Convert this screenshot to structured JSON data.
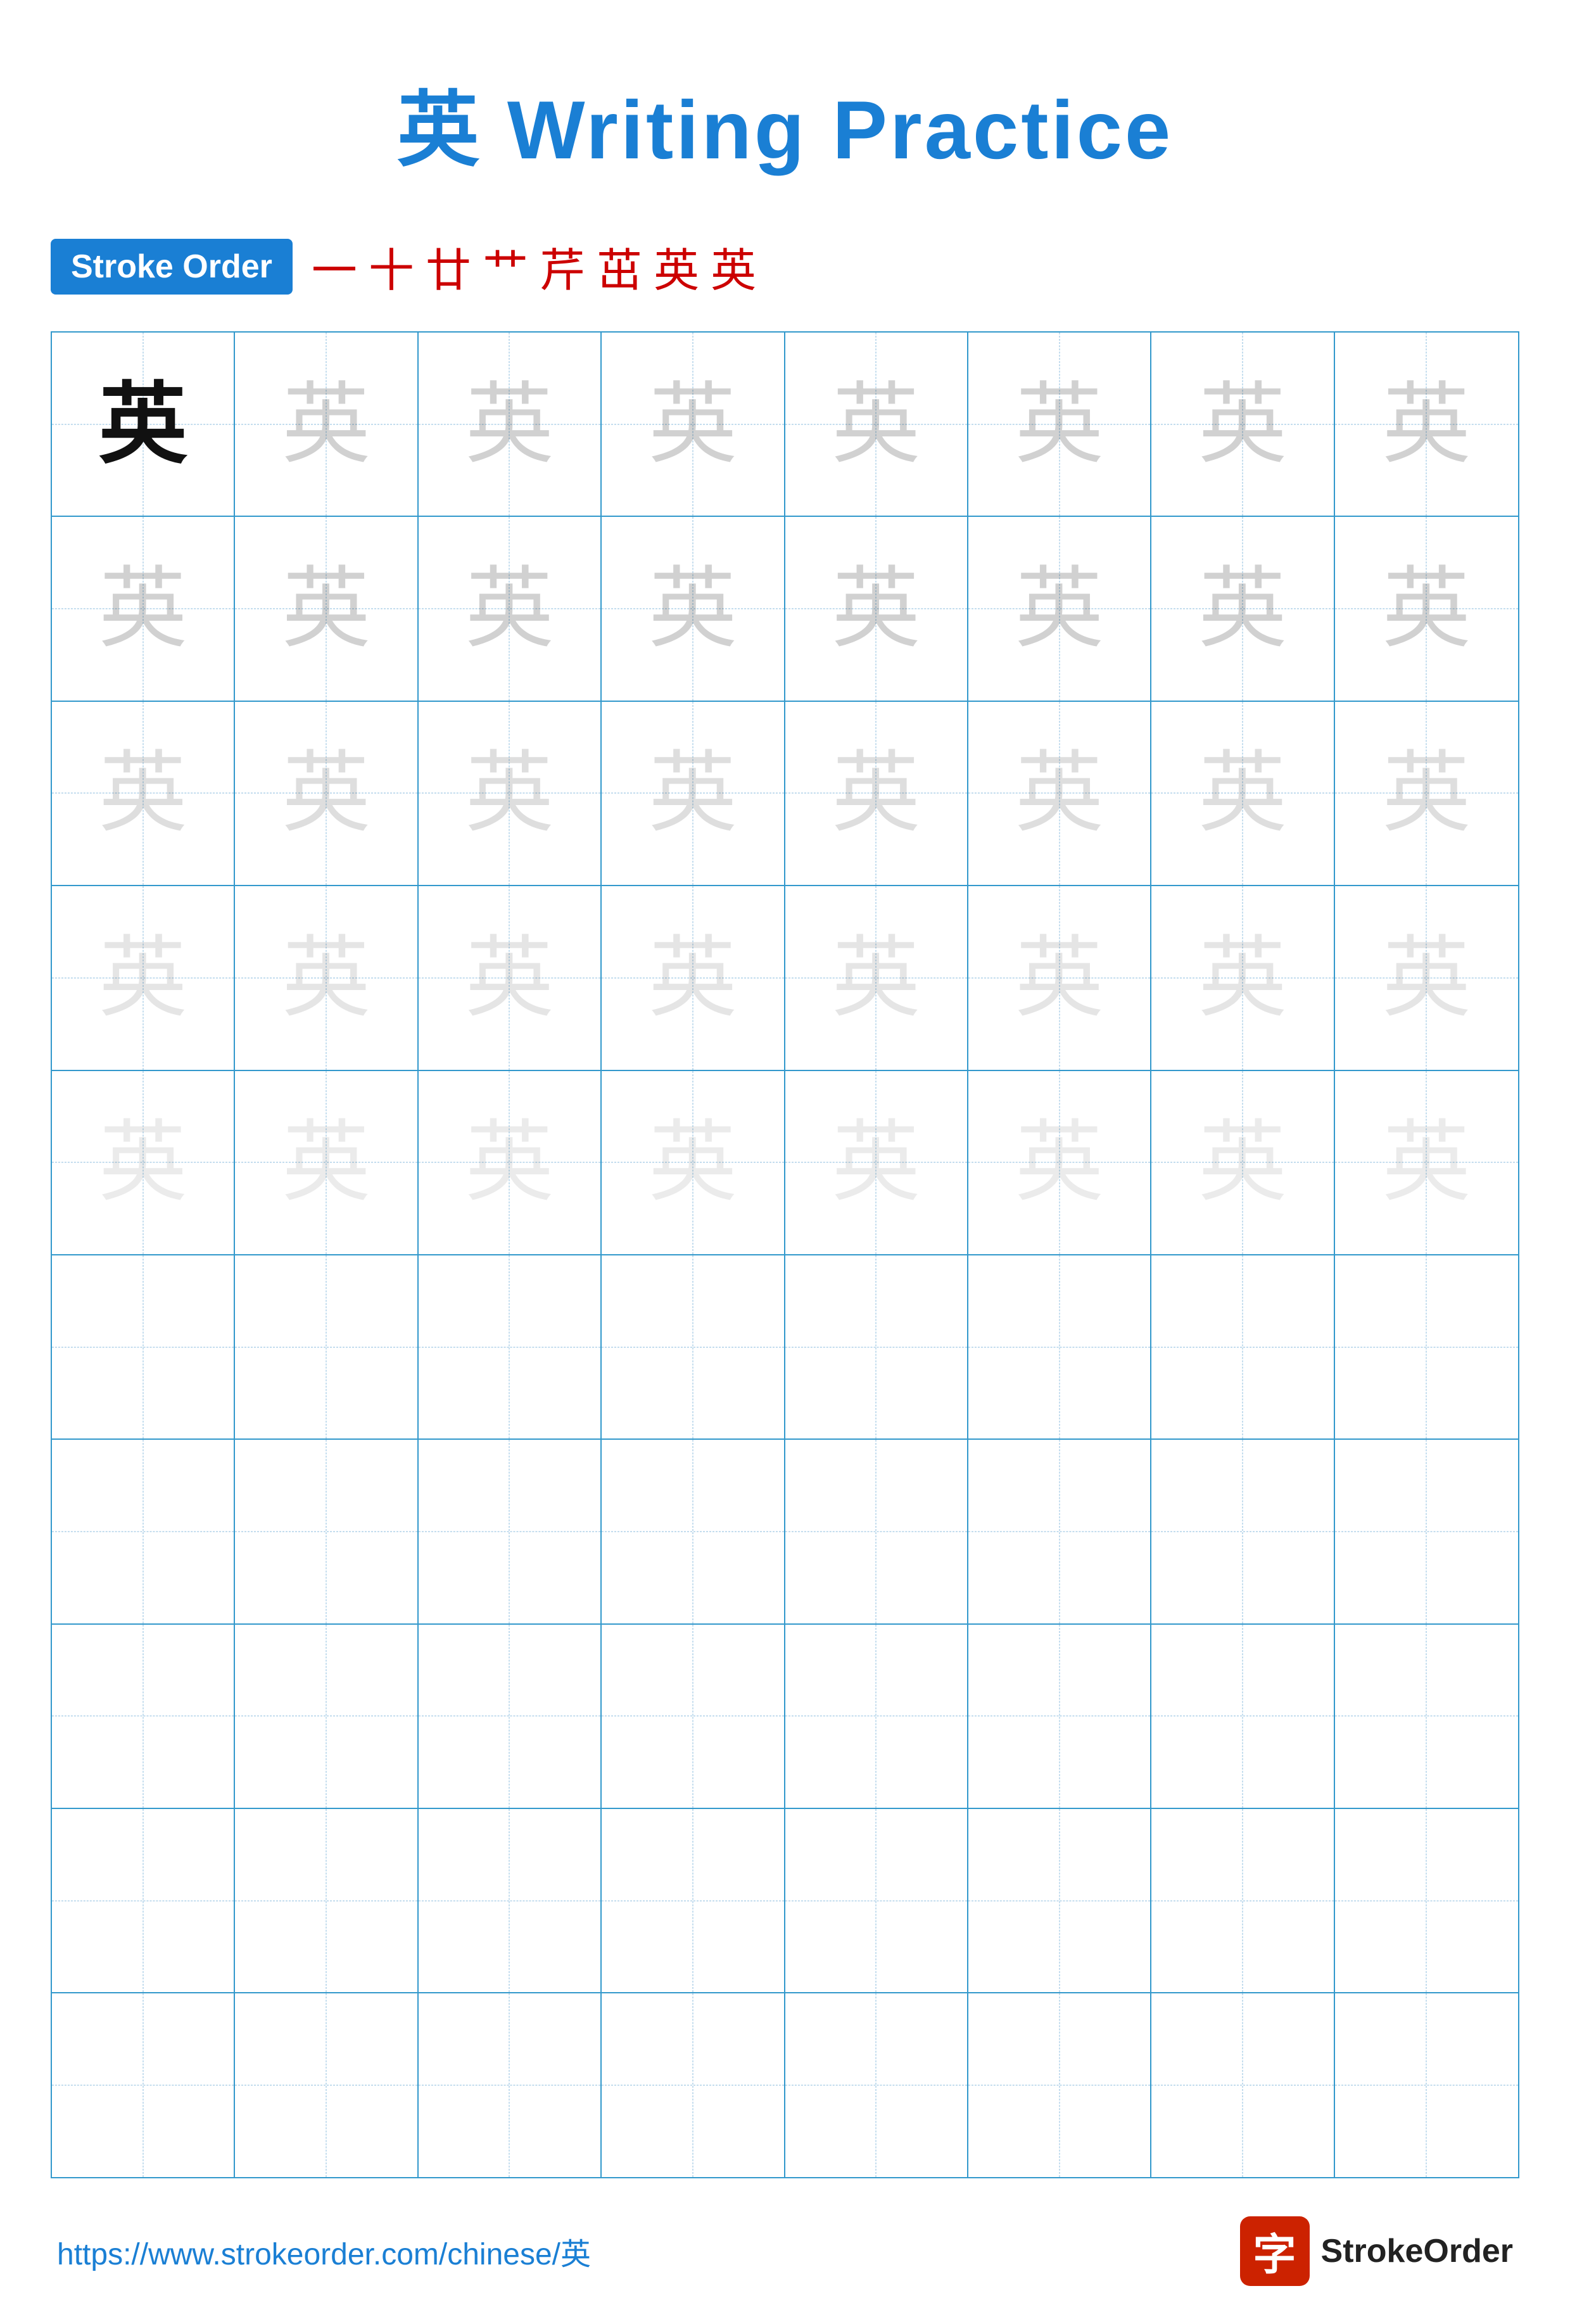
{
  "title": "英 Writing Practice",
  "stroke_order_label": "Stroke Order",
  "stroke_order_chars": [
    "一",
    "十",
    "廿",
    "艹",
    "芹",
    "茁",
    "英",
    "英"
  ],
  "character": "英",
  "grid": {
    "rows": 10,
    "cols": 8
  },
  "rows_with_chars": [
    {
      "row": 0,
      "styles": [
        "dark",
        "light-1",
        "light-1",
        "light-1",
        "light-1",
        "light-1",
        "light-1",
        "light-1"
      ]
    },
    {
      "row": 1,
      "styles": [
        "light-1",
        "light-1",
        "light-1",
        "light-1",
        "light-1",
        "light-1",
        "light-1",
        "light-1"
      ]
    },
    {
      "row": 2,
      "styles": [
        "light-2",
        "light-2",
        "light-2",
        "light-2",
        "light-2",
        "light-2",
        "light-2",
        "light-2"
      ]
    },
    {
      "row": 3,
      "styles": [
        "light-3",
        "light-3",
        "light-3",
        "light-3",
        "light-3",
        "light-3",
        "light-3",
        "light-3"
      ]
    },
    {
      "row": 4,
      "styles": [
        "light-4",
        "light-4",
        "light-4",
        "light-4",
        "light-4",
        "light-4",
        "light-4",
        "light-4"
      ]
    }
  ],
  "footer": {
    "url": "https://www.strokeorder.com/chinese/英",
    "logo_text": "StrokeOrder",
    "logo_icon": "字"
  }
}
